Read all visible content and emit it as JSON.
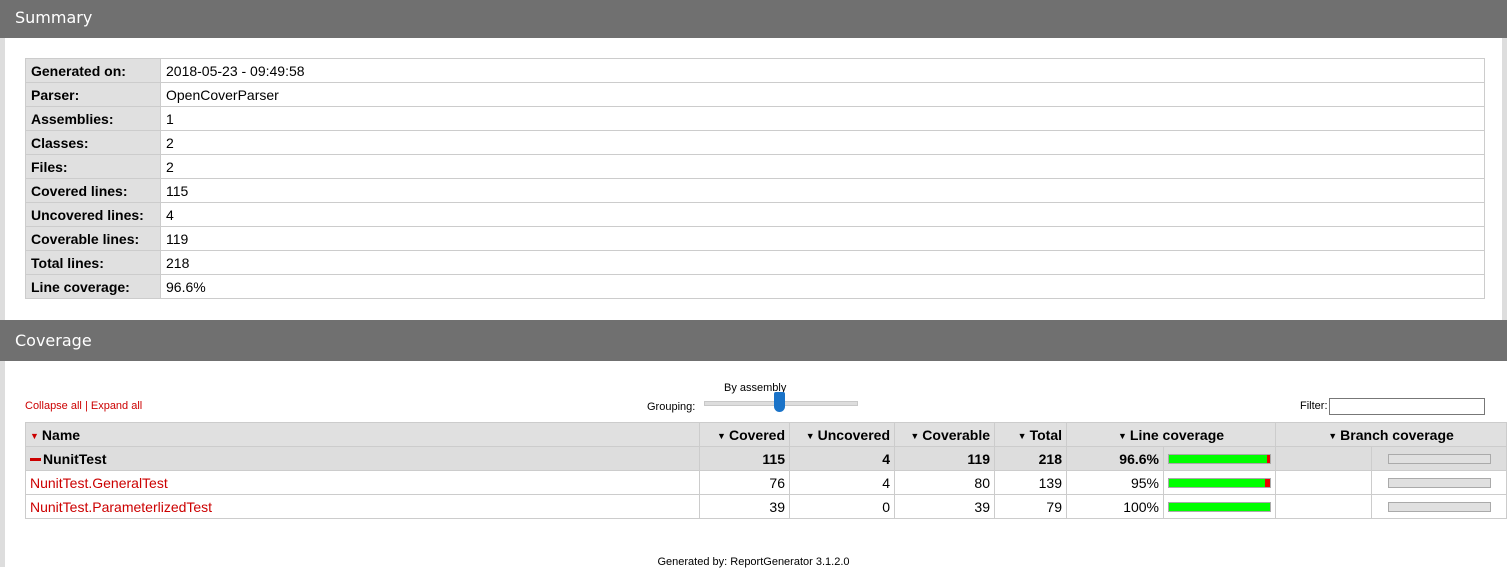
{
  "summary": {
    "header": "Summary",
    "rows": [
      {
        "label": "Generated on:",
        "value": "2018-05-23 - 09:49:58"
      },
      {
        "label": "Parser:",
        "value": "OpenCoverParser"
      },
      {
        "label": "Assemblies:",
        "value": "1"
      },
      {
        "label": "Classes:",
        "value": "2"
      },
      {
        "label": "Files:",
        "value": "2"
      },
      {
        "label": "Covered lines:",
        "value": "115"
      },
      {
        "label": "Uncovered lines:",
        "value": "4"
      },
      {
        "label": "Coverable lines:",
        "value": "119"
      },
      {
        "label": "Total lines:",
        "value": "218"
      },
      {
        "label": "Line coverage:",
        "value": "96.6%"
      }
    ]
  },
  "coverage": {
    "header": "Coverage",
    "collapse_all": "Collapse all",
    "separator": "|",
    "expand_all": "Expand all",
    "grouping_label": "Grouping:",
    "grouping_value": "By assembly",
    "grouping_level": 0.5,
    "filter_label": "Filter:",
    "filter_value": "",
    "columns": {
      "name": "Name",
      "covered": "Covered",
      "uncovered": "Uncovered",
      "coverable": "Coverable",
      "total": "Total",
      "line_coverage": "Line coverage",
      "branch_coverage": "Branch coverage"
    },
    "assembly": {
      "name": "NunitTest",
      "covered": "115",
      "uncovered": "4",
      "coverable": "119",
      "total": "218",
      "line_coverage": "96.6%",
      "line_fraction": 0.966
    },
    "classes": [
      {
        "name": "NunitTest.GeneralTest",
        "covered": "76",
        "uncovered": "4",
        "coverable": "80",
        "total": "139",
        "line_coverage": "95%",
        "line_fraction": 0.95
      },
      {
        "name": "NunitTest.ParameterlizedTest",
        "covered": "39",
        "uncovered": "0",
        "coverable": "39",
        "total": "79",
        "line_coverage": "100%",
        "line_fraction": 1.0
      }
    ]
  },
  "footer": {
    "text": "Generated by: ReportGenerator 3.1.2.0"
  },
  "colors": {
    "header_bg": "#707070",
    "covered": "#00ff00",
    "uncovered": "#ee0000",
    "link": "#cc0000"
  }
}
